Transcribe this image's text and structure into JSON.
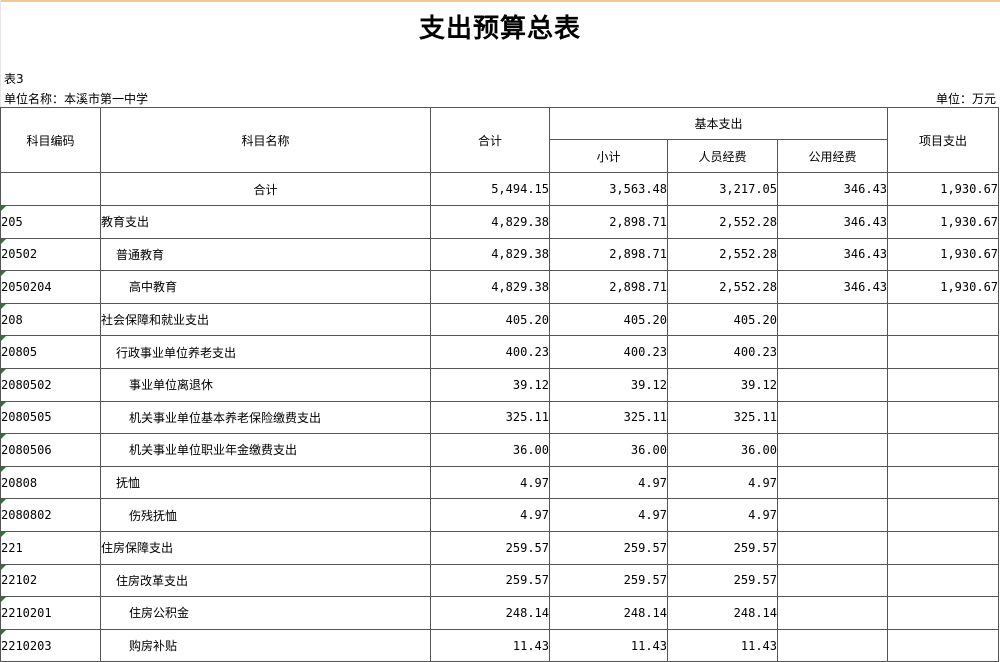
{
  "title": "支出预算总表",
  "table_no": "表3",
  "unit_name": "单位名称：本溪市第一中学",
  "unit": "单位：万元",
  "headers": {
    "code": "科目编码",
    "name": "科目名称",
    "total": "合计",
    "basic": "基本支出",
    "subtotal": "小计",
    "personnel": "人员经费",
    "public": "公用经费",
    "project": "项目支出"
  },
  "rows": [
    {
      "code": "",
      "name": "合计",
      "total": "5,494.15",
      "subtotal": "3,563.48",
      "personnel": "3,217.05",
      "public": "346.43",
      "project": "1,930.67"
    },
    {
      "code": "205",
      "name": "教育支出",
      "total": "4,829.38",
      "subtotal": "2,898.71",
      "personnel": "2,552.28",
      "public": "346.43",
      "project": "1,930.67"
    },
    {
      "code": "20502",
      "name": "普通教育",
      "total": "4,829.38",
      "subtotal": "2,898.71",
      "personnel": "2,552.28",
      "public": "346.43",
      "project": "1,930.67"
    },
    {
      "code": "2050204",
      "name": "高中教育",
      "total": "4,829.38",
      "subtotal": "2,898.71",
      "personnel": "2,552.28",
      "public": "346.43",
      "project": "1,930.67"
    },
    {
      "code": "208",
      "name": "社会保障和就业支出",
      "total": "405.20",
      "subtotal": "405.20",
      "personnel": "405.20",
      "public": "",
      "project": ""
    },
    {
      "code": "20805",
      "name": "行政事业单位养老支出",
      "total": "400.23",
      "subtotal": "400.23",
      "personnel": "400.23",
      "public": "",
      "project": ""
    },
    {
      "code": "2080502",
      "name": "事业单位离退休",
      "total": "39.12",
      "subtotal": "39.12",
      "personnel": "39.12",
      "public": "",
      "project": ""
    },
    {
      "code": "2080505",
      "name": "机关事业单位基本养老保险缴费支出",
      "total": "325.11",
      "subtotal": "325.11",
      "personnel": "325.11",
      "public": "",
      "project": ""
    },
    {
      "code": "2080506",
      "name": "机关事业单位职业年金缴费支出",
      "total": "36.00",
      "subtotal": "36.00",
      "personnel": "36.00",
      "public": "",
      "project": ""
    },
    {
      "code": "20808",
      "name": "抚恤",
      "total": "4.97",
      "subtotal": "4.97",
      "personnel": "4.97",
      "public": "",
      "project": ""
    },
    {
      "code": "2080802",
      "name": "伤残抚恤",
      "total": "4.97",
      "subtotal": "4.97",
      "personnel": "4.97",
      "public": "",
      "project": ""
    },
    {
      "code": "221",
      "name": "住房保障支出",
      "total": "259.57",
      "subtotal": "259.57",
      "personnel": "259.57",
      "public": "",
      "project": ""
    },
    {
      "code": "22102",
      "name": "住房改革支出",
      "total": "259.57",
      "subtotal": "259.57",
      "personnel": "259.57",
      "public": "",
      "project": ""
    },
    {
      "code": "2210201",
      "name": "住房公积金",
      "total": "248.14",
      "subtotal": "248.14",
      "personnel": "248.14",
      "public": "",
      "project": ""
    },
    {
      "code": "2210203",
      "name": "购房补贴",
      "total": "11.43",
      "subtotal": "11.43",
      "personnel": "11.43",
      "public": "",
      "project": ""
    }
  ]
}
